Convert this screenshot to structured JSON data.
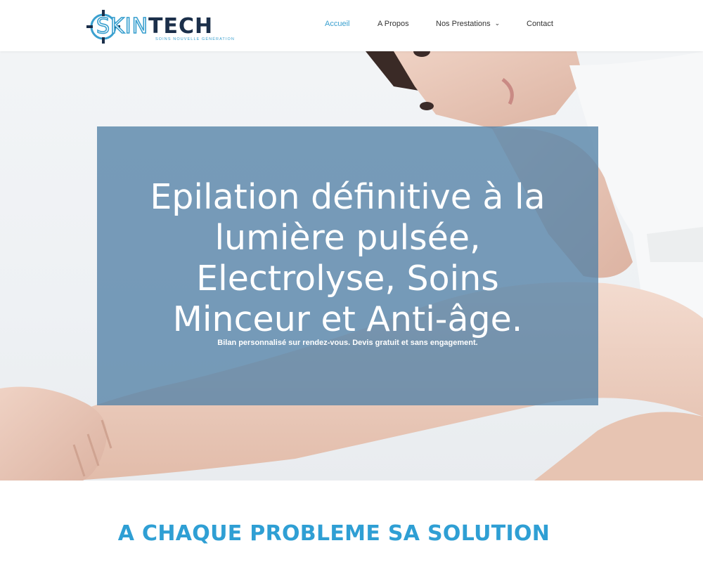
{
  "header": {
    "logo": {
      "skin": "SKIN",
      "tech": "TECH",
      "tagline": "Soins nouvelle génération"
    },
    "nav": [
      {
        "label": "Accueil",
        "active": true
      },
      {
        "label": "A Propos",
        "active": false
      },
      {
        "label": "Nos Prestations",
        "active": false,
        "has_dropdown": true,
        "dropdown_icon": "chevron-down-icon"
      },
      {
        "label": "Contact",
        "active": false
      }
    ]
  },
  "hero": {
    "title": "Epilation définitive à la lumière pulsée, Electrolyse, Soins Minceur et Anti-âge.",
    "subtitle": "Bilan personnalisé sur rendez-vous. Devis gratuit et sans engagement."
  },
  "section": {
    "title": "A CHAQUE PROBLEME SA SOLUTION"
  },
  "colors": {
    "accent": "#3aa0cf",
    "dark": "#1b2f4a",
    "overlay": "#5381a6",
    "section_title": "#2f9fd4"
  }
}
